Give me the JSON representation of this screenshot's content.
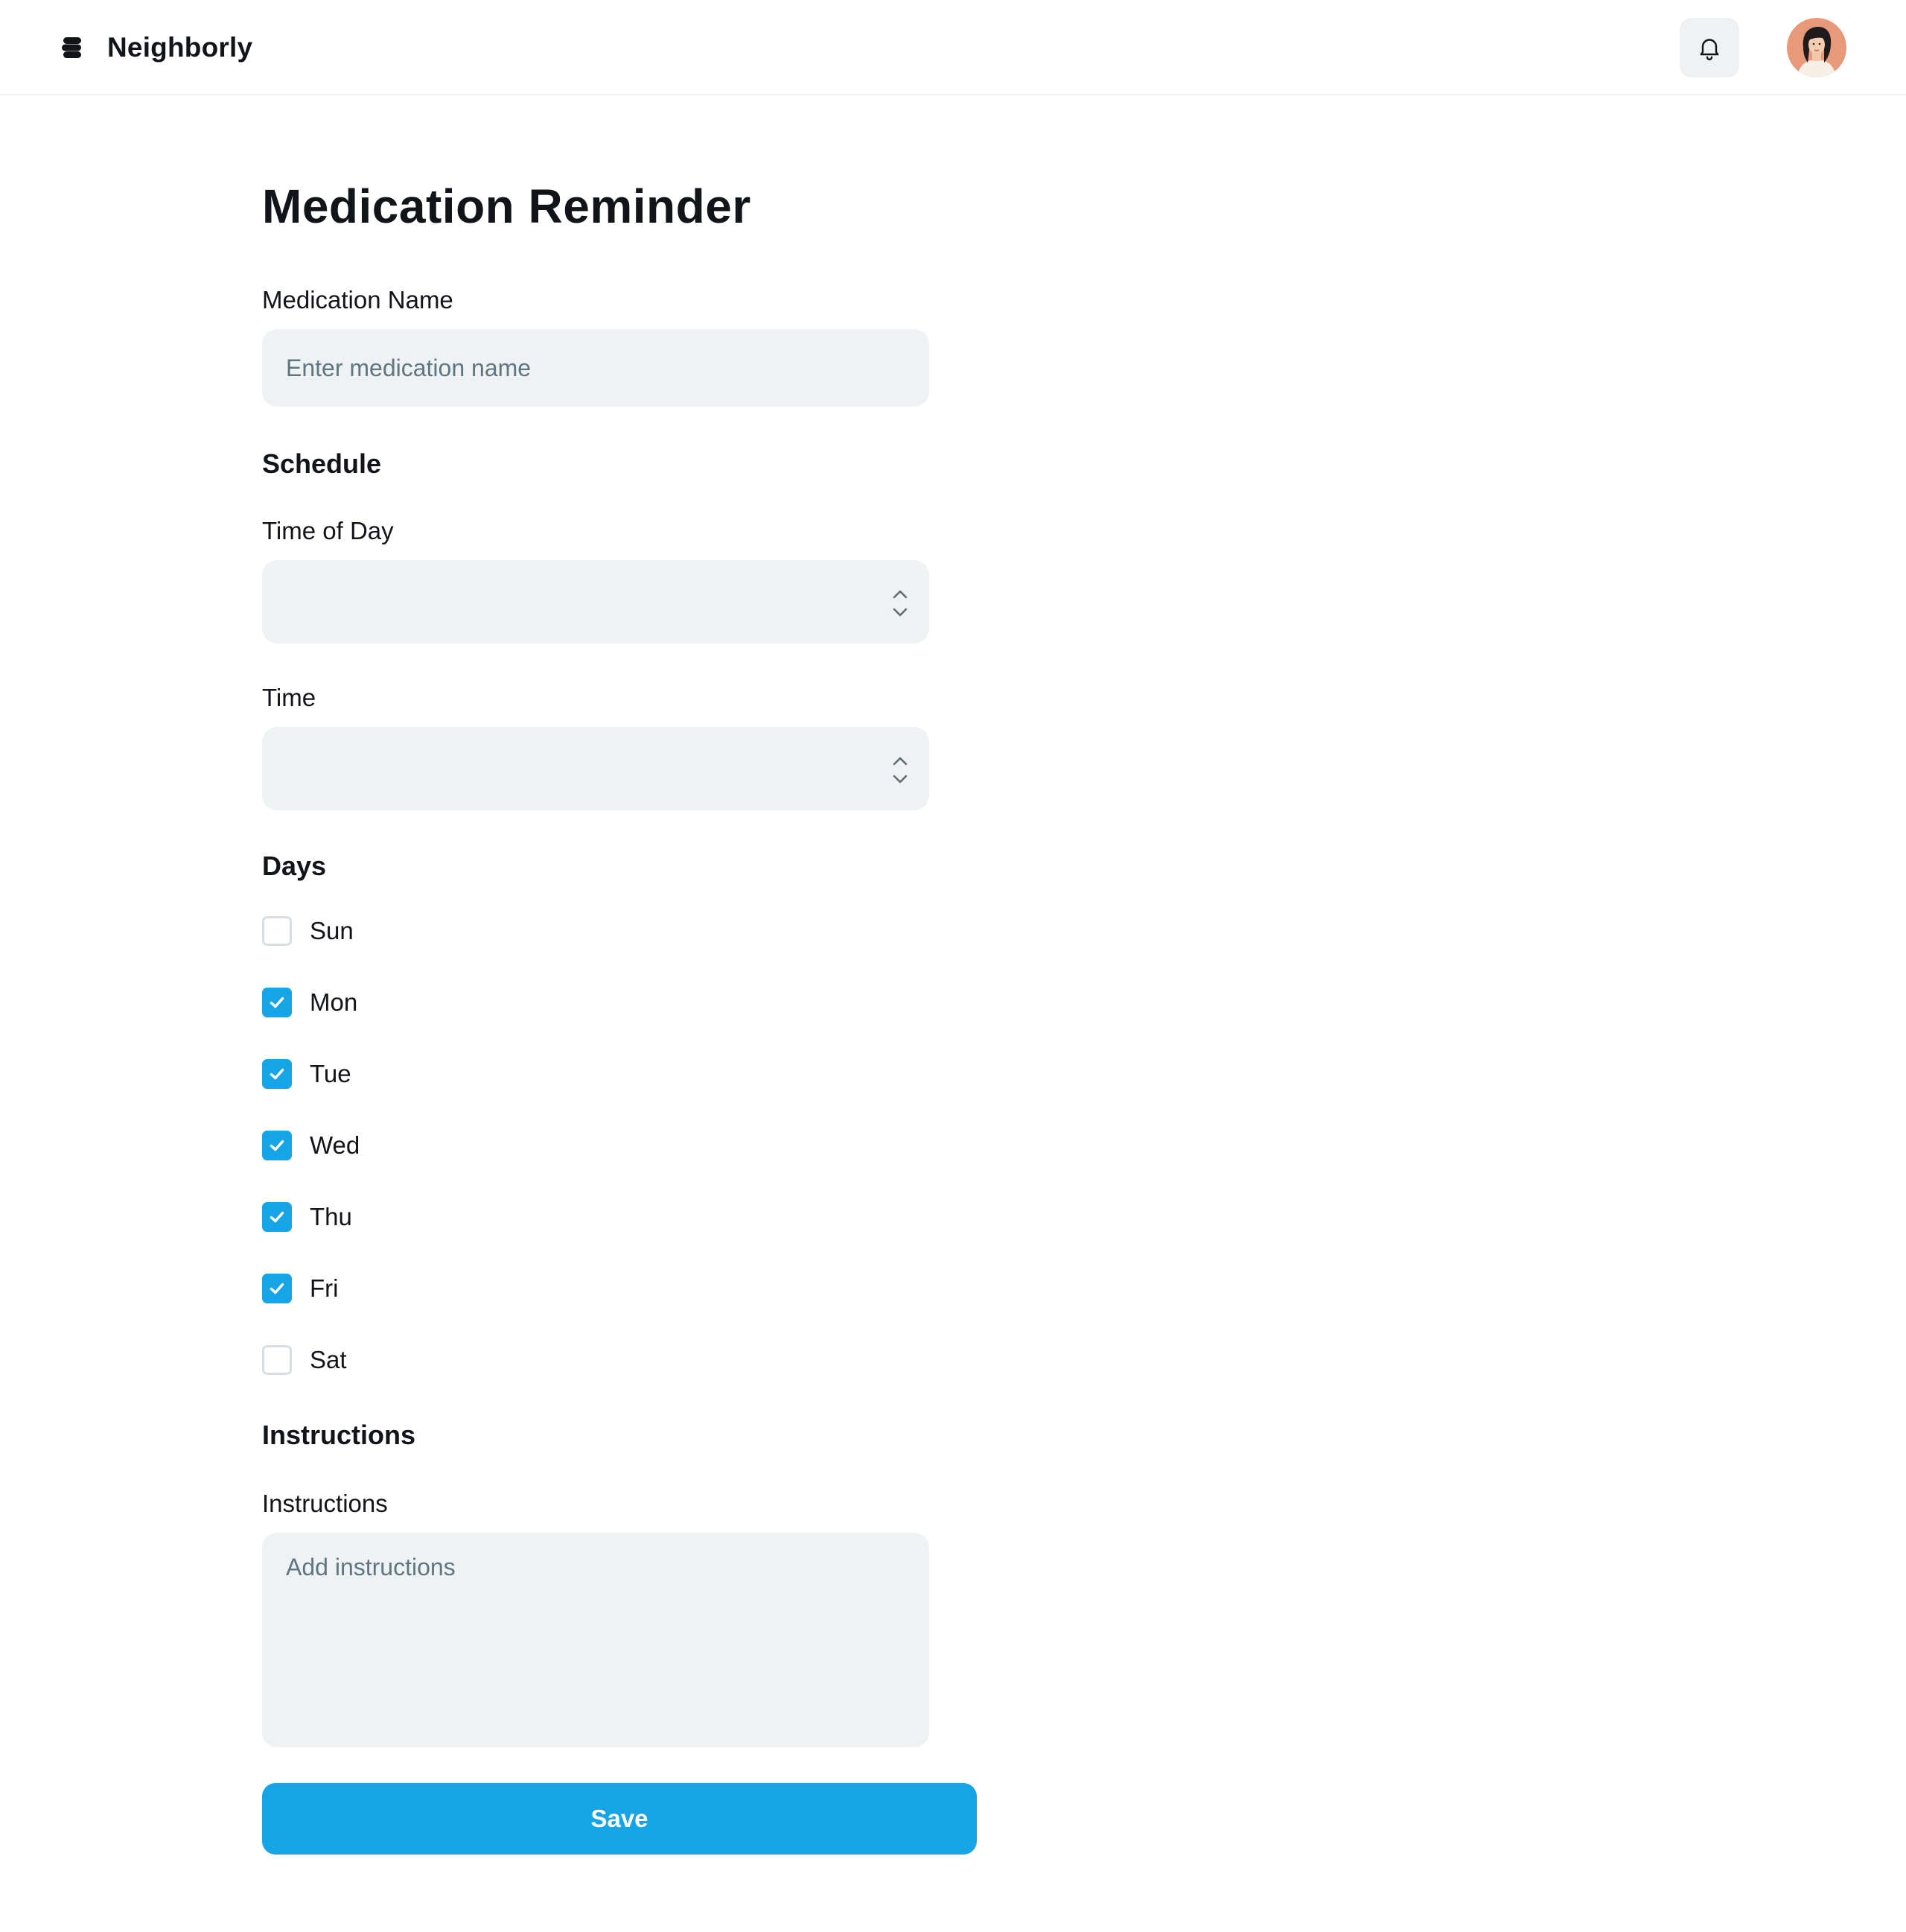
{
  "header": {
    "brand_name": "Neighborly",
    "logo_icon": "stacked-layers-icon",
    "notifications_icon": "bell-icon",
    "avatar_alt": "User avatar"
  },
  "page": {
    "title": "Medication Reminder"
  },
  "form": {
    "medication_name": {
      "label": "Medication Name",
      "placeholder": "Enter medication name",
      "value": ""
    },
    "schedule": {
      "heading": "Schedule",
      "time_of_day": {
        "label": "Time of Day",
        "value": ""
      },
      "time": {
        "label": "Time",
        "value": ""
      }
    },
    "days": {
      "heading": "Days",
      "items": [
        {
          "label": "Sun",
          "checked": false
        },
        {
          "label": "Mon",
          "checked": true
        },
        {
          "label": "Tue",
          "checked": true
        },
        {
          "label": "Wed",
          "checked": true
        },
        {
          "label": "Thu",
          "checked": true
        },
        {
          "label": "Fri",
          "checked": true
        },
        {
          "label": "Sat",
          "checked": false
        }
      ]
    },
    "instructions": {
      "heading": "Instructions",
      "label": "Instructions",
      "placeholder": "Add instructions",
      "value": ""
    },
    "save_label": "Save"
  },
  "colors": {
    "accent": "#16a4e6",
    "field_bg": "#eff2f3",
    "text": "#111418",
    "placeholder": "#5f7580"
  }
}
